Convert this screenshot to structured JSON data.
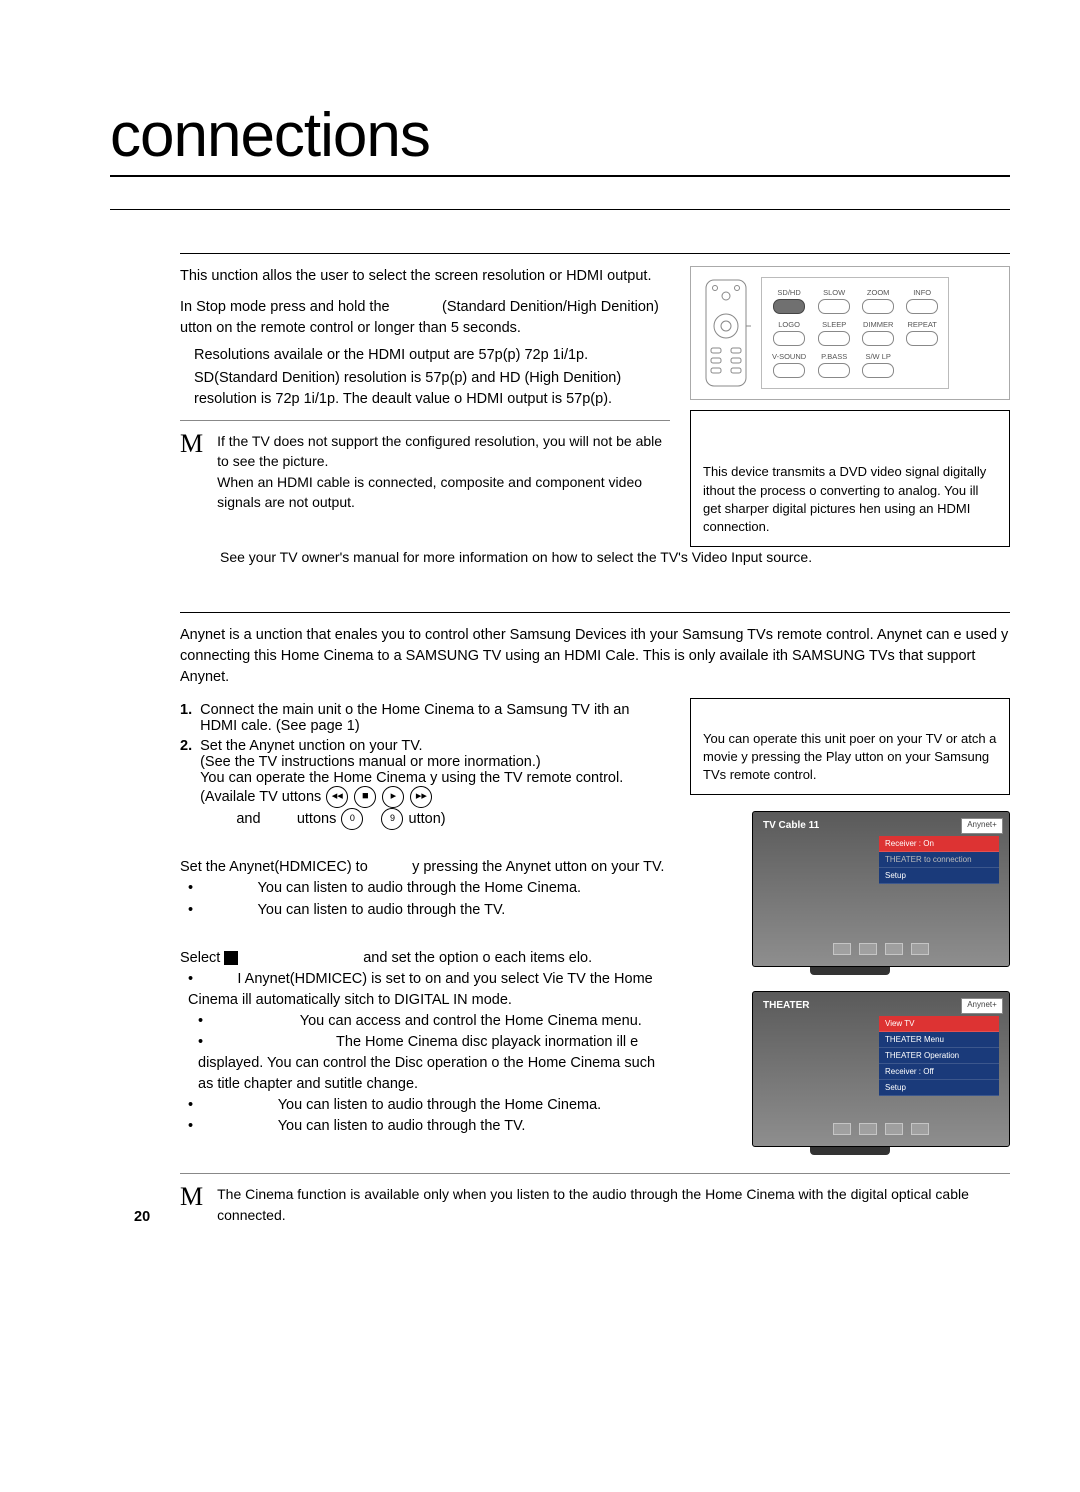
{
  "title": "connections",
  "page_number": "20",
  "hdmi": {
    "intro": "This unction allos the user to select the screen resolution or HDMI output.",
    "step_a": "In Stop mode press and hold the",
    "step_b": "(Standard Denition/High Denition) utton on the remote control or longer than 5 seconds.",
    "bullet1": "Resolutions availale or the HDMI output are 57p(p) 72p 1i/1p.",
    "bullet2": "SD(Standard Denition) resolution is 57p(p) and HD (High Denition) resolution is 72p 1i/1p. The deault value o HDMI output is 57p(p).",
    "note1": "If the TV does not support the configured resolution, you will not be able to see the picture.",
    "note2": "When an HDMI cable is connected, composite and component video signals are not output.",
    "note3": "See your TV owner's manual for more information on how to select the TV's Video Input source.",
    "callout_head": "",
    "callout_body": "This device transmits a DVD video signal digitally ithout the process o converting to analog. You ill get sharper digital pictures hen using an HDMI connection."
  },
  "remote_buttons": [
    "SD/HD",
    "SLOW",
    "ZOOM",
    "INFO",
    "LOGO",
    "SLEEP",
    "DIMMER",
    "REPEAT",
    "V-SOUND",
    "P.BASS",
    "S/W LP"
  ],
  "anynet": {
    "intro": "Anynet is a unction that enales you to control other Samsung Devices ith your Samsung TVs remote control. Anynet  can e used y connecting this Home Cinema to a SAMSUNG TV using an HDMI Cale. This is only availale ith SAMSUNG TVs that support Anynet.",
    "step1": "Connect the main unit o the Home Cinema to a Samsung TV ith an HDMI cale. (See page 1)",
    "step2": "Set the Anynet unction on your TV.",
    "step2b": "(See the TV instructions manual or more inormation.)",
    "step2c_a": "You can operate the Home Cinema y using the TV remote control. (Availale TV uttons",
    "step2c_b": "and",
    "step2c_c": "uttons",
    "step2c_d": "utton)",
    "tvmenu_label": "",
    "tvmenu_line1": "Set the Anynet(HDMICEC) to",
    "tvmenu_line1b": "y pressing the Anynet utton on your TV.",
    "tvmenu_opt1": "You can listen to audio through the Home Cinema.",
    "tvmenu_opt2": "You can listen to audio through the TV.",
    "theater_label": "",
    "theater_line1a": "Select",
    "theater_line1b": "and set the option o each items elo.",
    "opt_view_tv": "I Anynet(HDMICEC) is set to on and you select Vie TV the Home Cinema ill automatically sitch to DIGITAL IN mode.",
    "opt_menu": "You can access and control the Home Cinema menu.",
    "opt_oper": "The Home Cinema disc playack inormation ill e displayed. You can control the Disc operation o the Home Cinema such as title chapter and sutitle change.",
    "opt_recv_on": "You can listen to audio through the Home Cinema.",
    "opt_recv_off": "You can listen to audio through the TV.",
    "note": "The Cinema function is available only when you listen to the audio through the Home Cinema with the digital optical cable connected.",
    "callout_body": "You can operate this unit poer on your TV or atch a movie y pressing the Play utton on your Samsung TVs remote control."
  },
  "tv1": {
    "title": "TV Cable 11",
    "rows": [
      "Receiver : On",
      "THEATER to connection",
      "Setup"
    ]
  },
  "tv2": {
    "title": "THEATER",
    "rows": [
      "View TV",
      "THEATER Menu",
      "THEATER Operation",
      "Receiver : Off",
      "Setup"
    ]
  }
}
